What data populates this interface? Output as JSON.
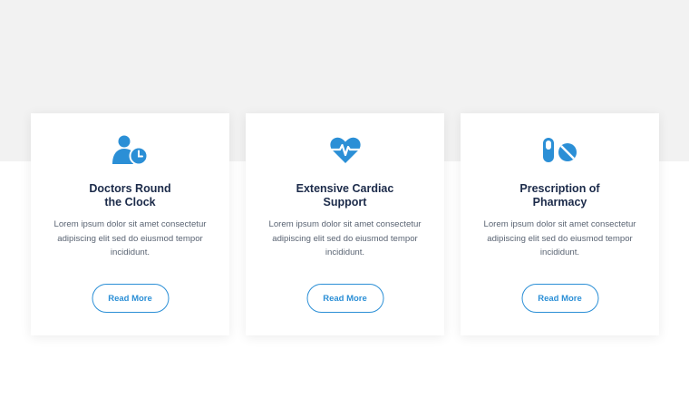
{
  "colors": {
    "accent": "#2b8fd6",
    "heading": "#1c2b4a",
    "text": "#5a6473",
    "band": "#f2f2f2"
  },
  "cards": [
    {
      "icon": "doctor-clock-icon",
      "title_line1": "Doctors Round",
      "title_line2": "the Clock",
      "body": "Lorem ipsum dolor sit amet consectetur adipiscing elit sed do eiusmod tempor incididunt.",
      "button": "Read More"
    },
    {
      "icon": "heart-pulse-icon",
      "title_line1": "Extensive Cardiac",
      "title_line2": "Support",
      "body": "Lorem ipsum dolor sit amet consectetur adipiscing elit sed do eiusmod tempor incididunt.",
      "button": "Read More"
    },
    {
      "icon": "pills-icon",
      "title_line1": "Prescription of",
      "title_line2": "Pharmacy",
      "body": "Lorem ipsum dolor sit amet consectetur adipiscing elit sed do eiusmod tempor incididunt.",
      "button": "Read More"
    }
  ]
}
